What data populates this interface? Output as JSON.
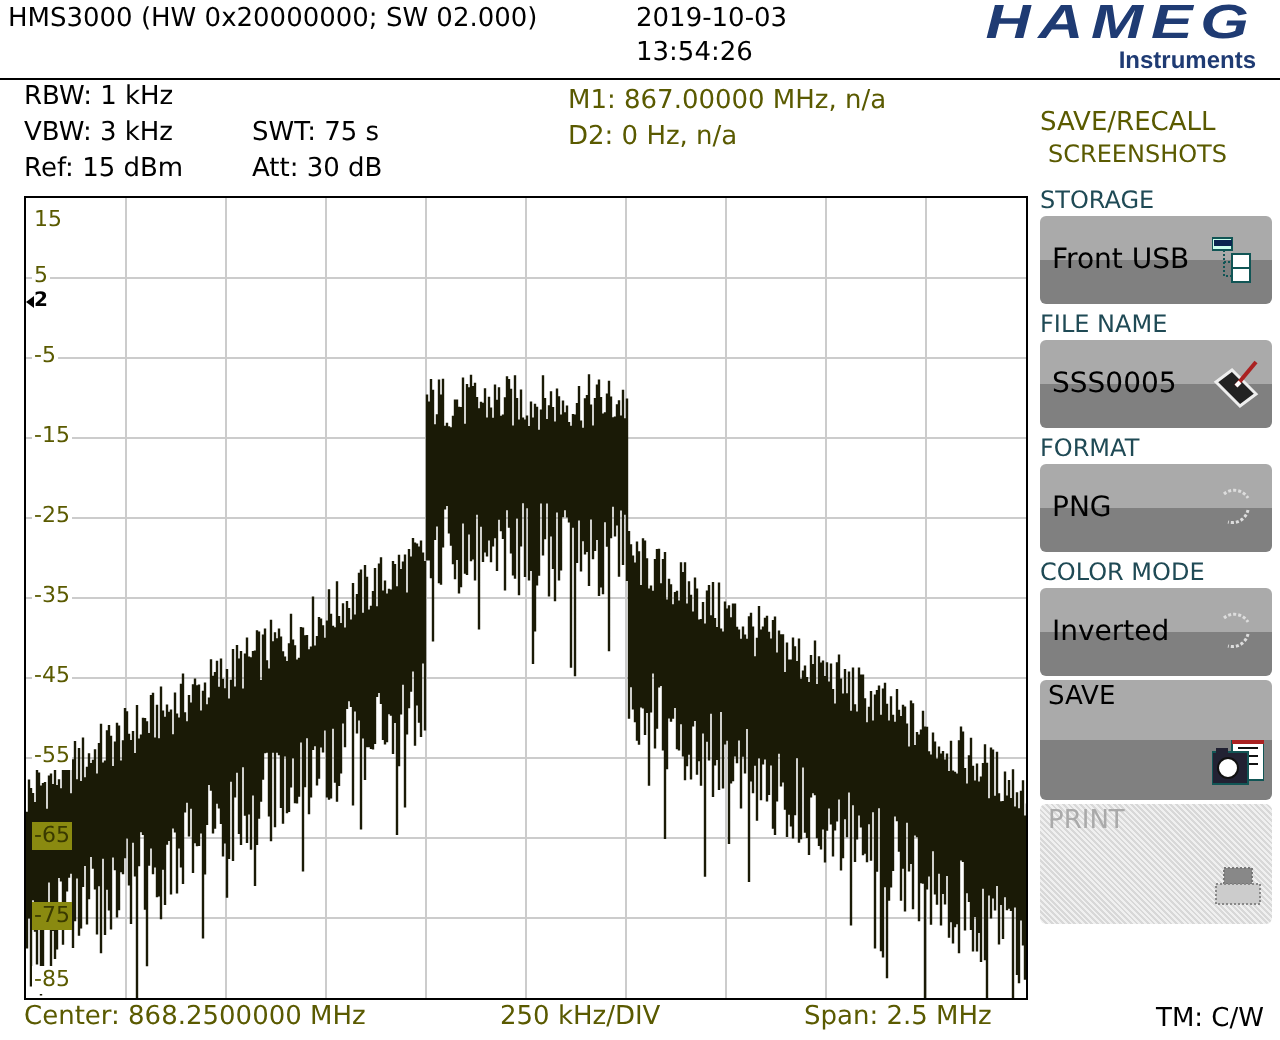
{
  "header": {
    "title": "HMS3000 (HW 0x20000000; SW 02.000)",
    "date": "2019-10-03",
    "time": "13:54:26",
    "logo": "HAMEG",
    "logo_sub": "Instruments"
  },
  "params": [
    {
      "text": "RBW: 1 kHz"
    },
    {
      "text": "VBW: 3 kHz"
    },
    {
      "text": "Ref: 15 dBm"
    }
  ],
  "params_2": [
    {
      "text": "SWT: 75 s"
    },
    {
      "text": "Att: 30 dB"
    }
  ],
  "markers": [
    {
      "text": "M1: 867.00000 MHz, n/a"
    },
    {
      "text": "D2: 0 Hz, n/a"
    }
  ],
  "menu": {
    "title": "SAVE/RECALL",
    "subtitle": "SCREENSHOTS"
  },
  "softkeys": [
    {
      "kind": "value",
      "label": "STORAGE",
      "value": "Front USB",
      "disabled": false
    },
    {
      "kind": "value",
      "label": "FILE NAME",
      "value": "SSS0005",
      "disabled": false
    },
    {
      "kind": "value",
      "label": "FORMAT",
      "value": "PNG",
      "disabled": false
    },
    {
      "kind": "value",
      "label": "COLOR MODE",
      "value": "Inverted",
      "disabled": false
    },
    {
      "kind": "action",
      "label": "SAVE",
      "disabled": false
    },
    {
      "kind": "action",
      "label": "PRINT",
      "disabled": true
    }
  ],
  "plot": {
    "y_ticks": [
      {
        "label": "15",
        "highlighted": false
      },
      {
        "label": "5",
        "highlighted": false
      },
      {
        "label": "-5",
        "highlighted": false
      },
      {
        "label": "-15",
        "highlighted": false
      },
      {
        "label": "-25",
        "highlighted": false
      },
      {
        "label": "-35",
        "highlighted": false
      },
      {
        "label": "-45",
        "highlighted": false
      },
      {
        "label": "-55",
        "highlighted": false
      },
      {
        "label": "-65",
        "highlighted": true
      },
      {
        "label": "-75",
        "highlighted": true
      },
      {
        "label": "-85",
        "highlighted": false
      }
    ],
    "marker_label": "2"
  },
  "footer": {
    "center": "Center: 868.2500000 MHz",
    "div": "250 kHz/DIV",
    "span": "Span: 2.5 MHz",
    "mode": "TM: C/W"
  }
}
